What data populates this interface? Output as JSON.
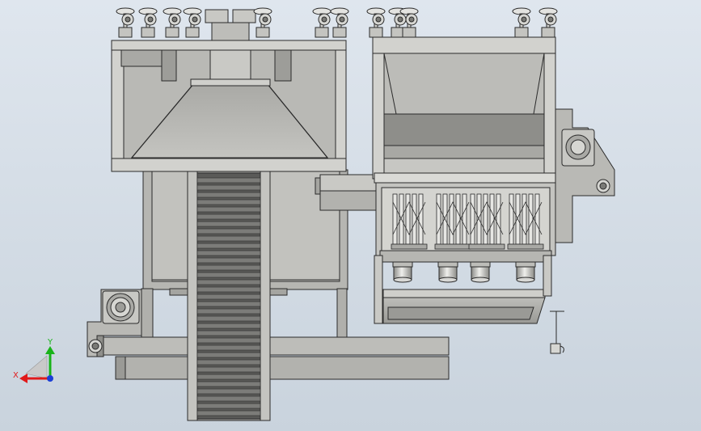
{
  "viewport": {
    "background_top": "#dfe6ee",
    "background_bottom": "#c9d3dd"
  },
  "colors": {
    "body": "#b9b9b5",
    "body_light": "#d0d0cc",
    "body_dark": "#8f8f8b",
    "shadow": "#6f6f6b",
    "edge": "#2b2b2b",
    "belt": "#5a5a58",
    "metal": "#e3e3e0"
  },
  "triad": {
    "x_label": "X",
    "y_label": "Y",
    "x_color": "#e11919",
    "y_color": "#19b319",
    "z_color": "#1b3ed6"
  },
  "icons": {
    "triad": "coordinate-triad-icon",
    "caster": "caster-wheel-icon",
    "motor": "motor-icon"
  }
}
